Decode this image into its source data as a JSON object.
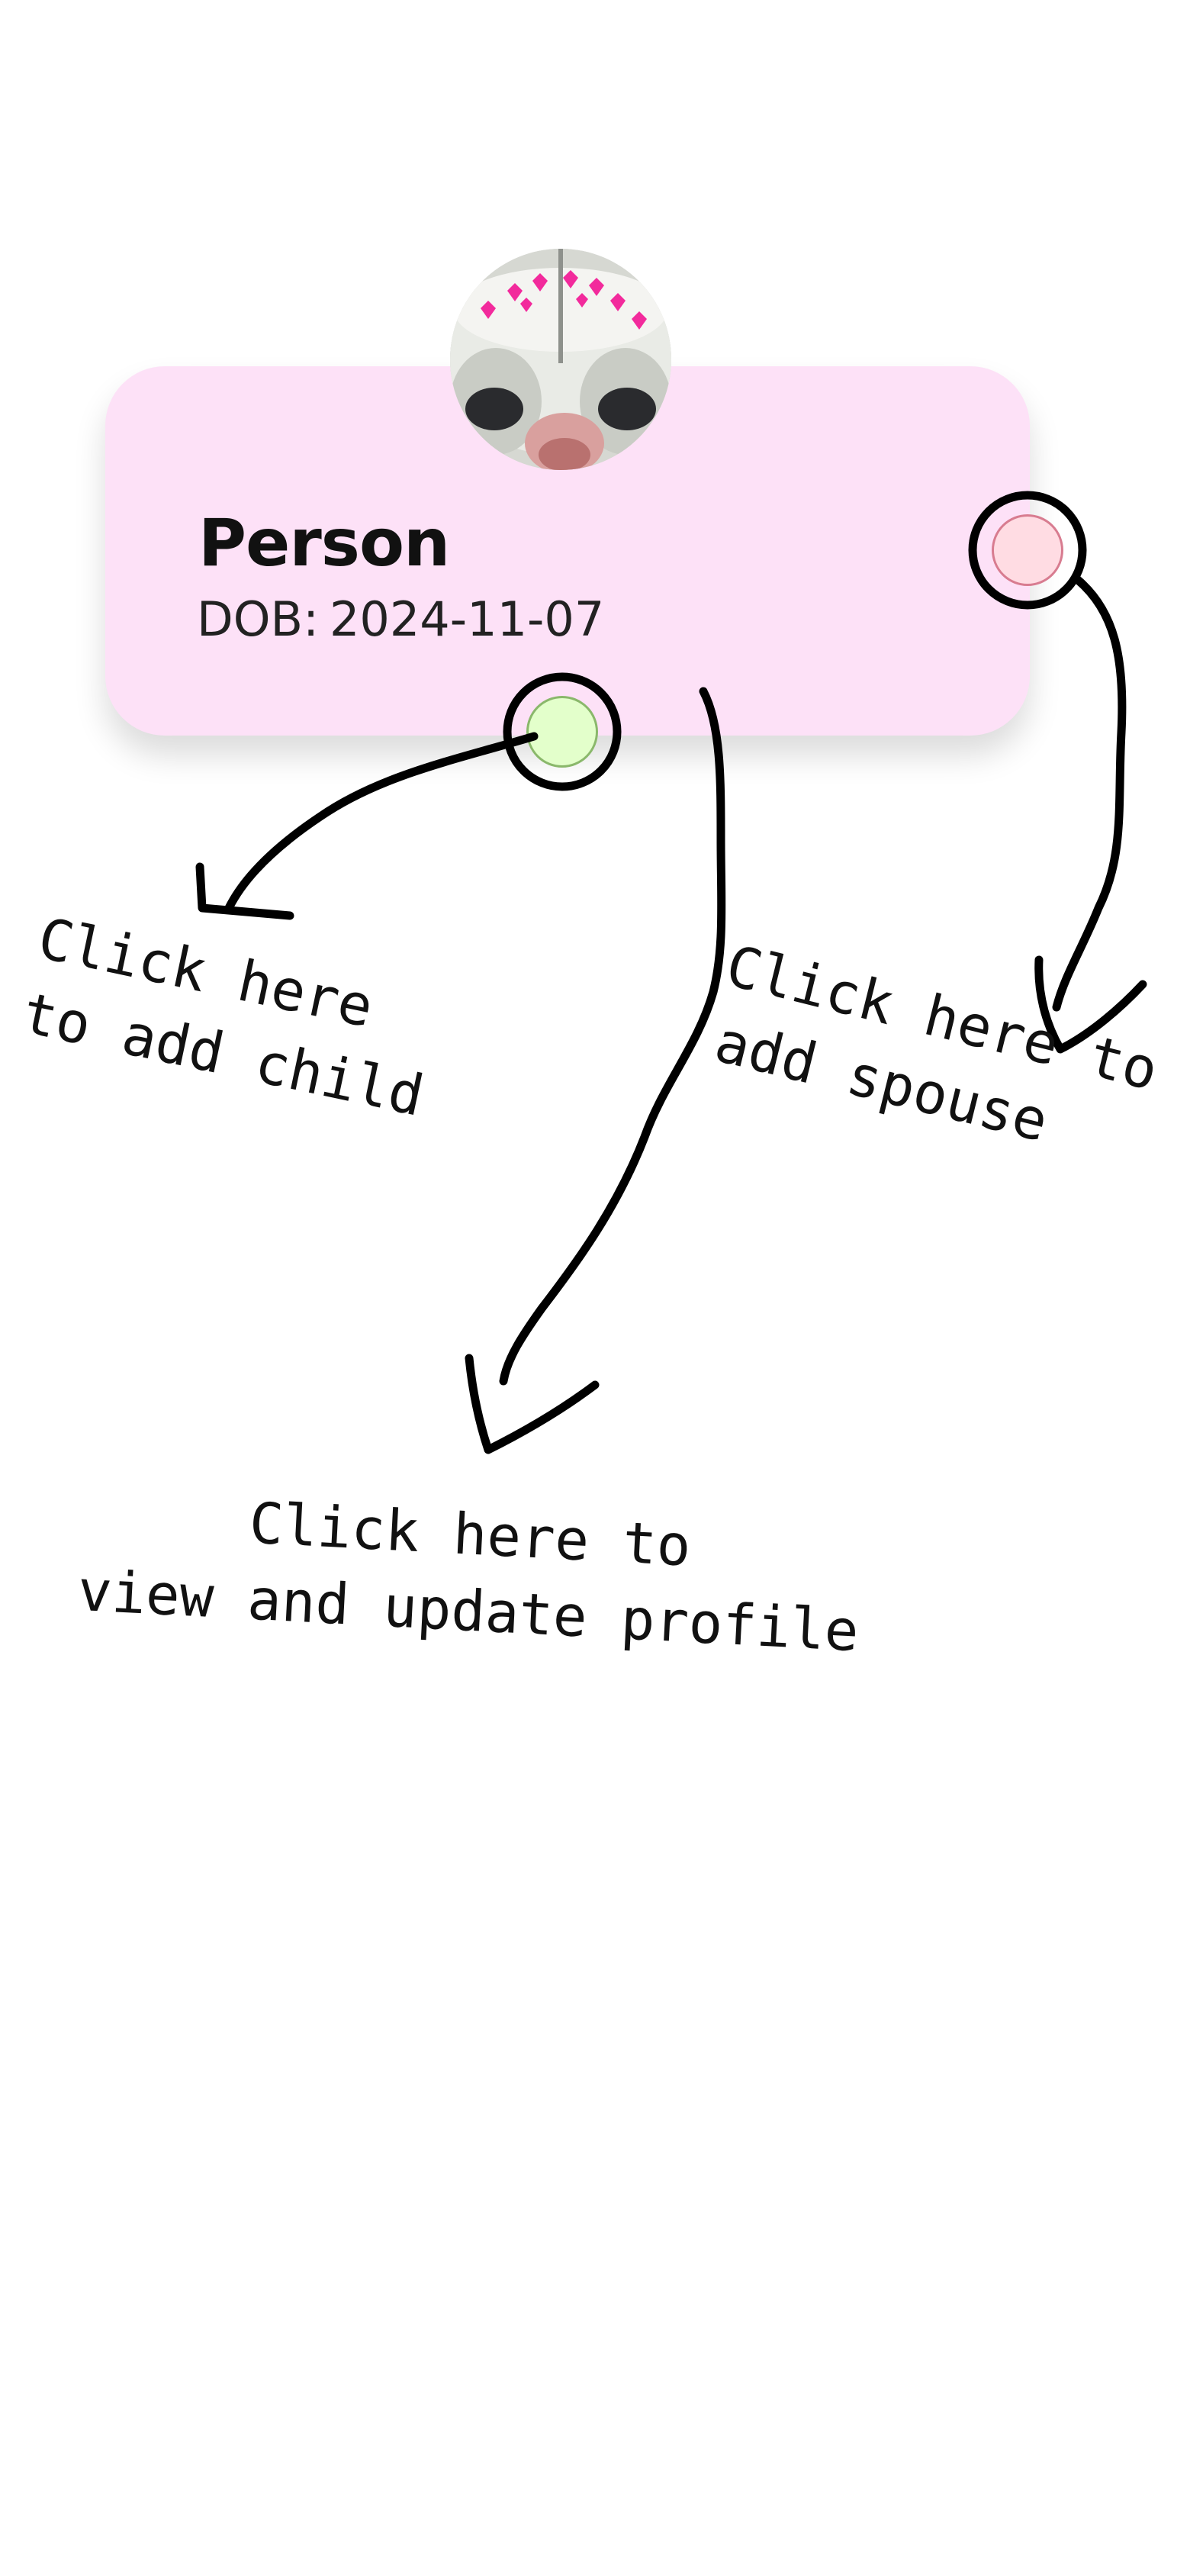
{
  "person": {
    "name": "Person",
    "dob_label": "DOB:",
    "dob_value": "2024-11-07"
  },
  "colors": {
    "card_background": "#fde1f7",
    "spouse_handle": "#ffdce3",
    "child_handle": "#e3ffcb"
  },
  "annotations": {
    "add_child": [
      "Click here",
      "to add child"
    ],
    "add_spouse": [
      "Click here to",
      "add spouse"
    ],
    "view_profile": [
      "Click here to",
      "view and update profile"
    ]
  },
  "icons": {
    "avatar": "cat-photo-avatar"
  }
}
